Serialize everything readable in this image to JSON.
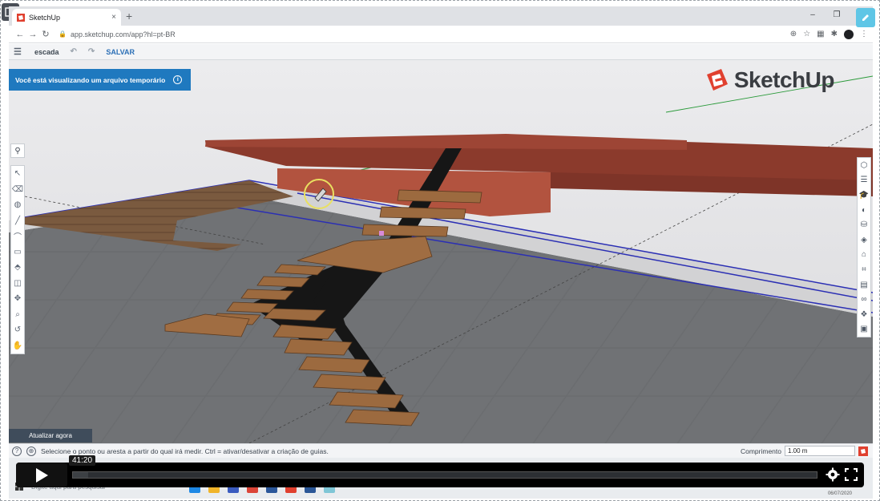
{
  "browser": {
    "tab_title": "SketchUp",
    "tab_close": "×",
    "new_tab": "+",
    "url": "app.sketchup.com/app?hl=pt-BR",
    "window_controls": [
      "–",
      "❐",
      "✕"
    ]
  },
  "app": {
    "document_name": "escada",
    "save_label": "SALVAR",
    "temp_banner": "Você está visualizando um arquivo temporário",
    "brand_name": "SketchUp",
    "update_now": "Atualizar agora",
    "status_message": "Selecione o ponto ou aresta a partir do qual irá medir. Ctrl = ativar/desativar a criação de guias.",
    "measure_label": "Comprimento",
    "measure_value": "1.00 m",
    "left_tools": [
      "select-tool-icon",
      "eraser-tool-icon",
      "paint-tool-icon",
      "line-tool-icon",
      "arc-tool-icon",
      "rectangle-tool-icon",
      "push-pull-tool-icon",
      "offset-tool-icon",
      "move-tool-icon",
      "tape-measure-tool-icon",
      "orbit-tool-icon",
      "pan-tool-icon"
    ],
    "right_tools": [
      "entity-info-icon",
      "instructor-icon",
      "components-icon",
      "materials-icon",
      "styles-icon",
      "layers-icon",
      "scenes-icon",
      "tags-icon",
      "display-icon",
      "glasses-icon",
      "outliner-icon",
      "solid-inspector-icon"
    ]
  },
  "taskbar": {
    "search_placeholder": "Digite aqui para pesquisar",
    "date": "06/07/2020"
  },
  "player": {
    "timecode": "41:20",
    "progress": 0.02
  },
  "colors": {
    "accent_blue": "#1f79bf",
    "brand_red": "#e0402f",
    "sky": "#e6e6e8",
    "floor": "#6a6c6f"
  }
}
